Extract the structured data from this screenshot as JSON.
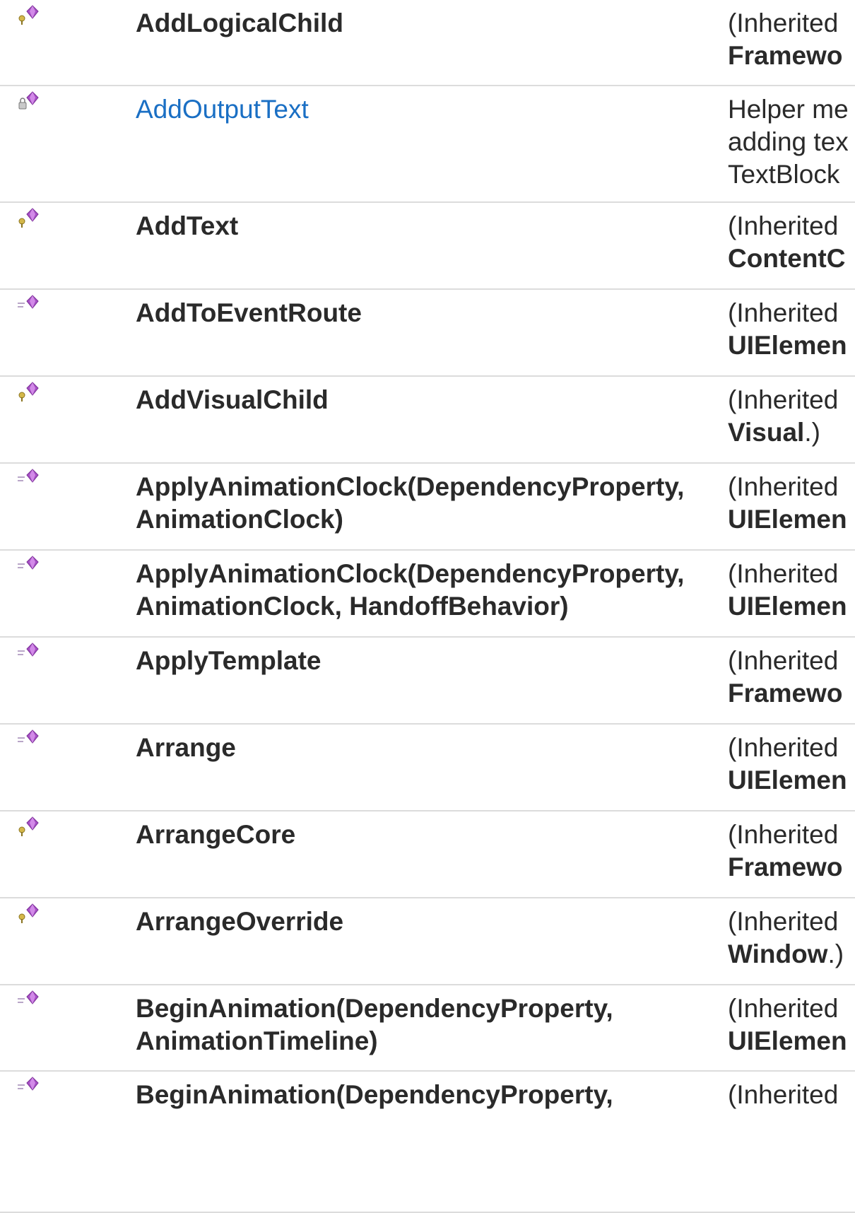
{
  "icons": {
    "method_protected": "protected-method-icon",
    "method_public": "public-method-icon",
    "method_private": "private-method-icon"
  },
  "colors": {
    "link": "#1a6fc4",
    "text": "#2a2a2a",
    "divider": "#dcdcdc"
  },
  "members": [
    {
      "name": "AddLogicalChild",
      "link": false,
      "access": "protected",
      "desc": [
        "(Inherited",
        "Framewo"
      ],
      "desc_bold_line": 1
    },
    {
      "name": "AddOutputText",
      "link": true,
      "access": "private",
      "desc": [
        "Helper me",
        "adding tex",
        "TextBlock"
      ],
      "desc_bold_line": -1
    },
    {
      "name": "AddText",
      "link": false,
      "access": "protected",
      "desc": [
        "(Inherited",
        "ContentC"
      ],
      "desc_bold_line": 1
    },
    {
      "name": "AddToEventRoute",
      "link": false,
      "access": "public",
      "desc": [
        "(Inherited",
        "UIElemen"
      ],
      "desc_bold_line": 1
    },
    {
      "name": "AddVisualChild",
      "link": false,
      "access": "protected",
      "desc": [
        "(Inherited",
        "Visual.)"
      ],
      "desc_bold_line": 1
    },
    {
      "name": "ApplyAnimationClock(DependencyProperty, AnimationClock)",
      "link": false,
      "access": "public",
      "desc": [
        "(Inherited",
        "UIElemen"
      ],
      "desc_bold_line": 1
    },
    {
      "name": "ApplyAnimationClock(DependencyProperty, AnimationClock, HandoffBehavior)",
      "link": false,
      "access": "public",
      "desc": [
        "(Inherited",
        "UIElemen"
      ],
      "desc_bold_line": 1
    },
    {
      "name": "ApplyTemplate",
      "link": false,
      "access": "public",
      "desc": [
        "(Inherited",
        "Framewo"
      ],
      "desc_bold_line": 1
    },
    {
      "name": "Arrange",
      "link": false,
      "access": "public",
      "desc": [
        "(Inherited",
        "UIElemen"
      ],
      "desc_bold_line": 1
    },
    {
      "name": "ArrangeCore",
      "link": false,
      "access": "protected",
      "desc": [
        "(Inherited",
        "Framewo"
      ],
      "desc_bold_line": 1
    },
    {
      "name": "ArrangeOverride",
      "link": false,
      "access": "protected",
      "desc": [
        "(Inherited",
        "Window.)"
      ],
      "desc_bold_line": 1
    },
    {
      "name": "BeginAnimation(DependencyProperty, AnimationTimeline)",
      "link": false,
      "access": "public",
      "desc": [
        "(Inherited",
        "UIElemen"
      ],
      "desc_bold_line": 1
    },
    {
      "name": "BeginAnimation(DependencyProperty,",
      "link": false,
      "access": "public",
      "desc": [
        "(Inherited"
      ],
      "desc_bold_line": -1
    }
  ]
}
